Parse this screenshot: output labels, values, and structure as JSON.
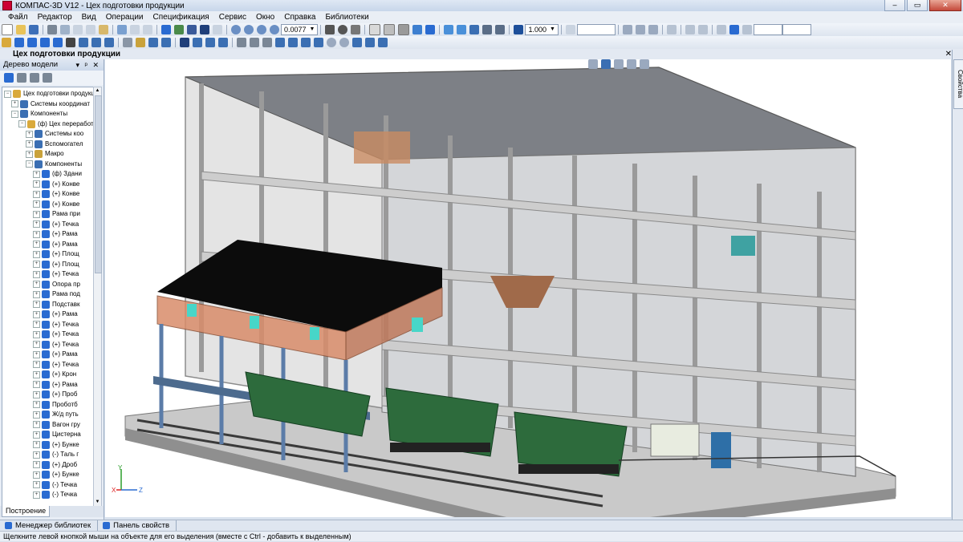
{
  "window": {
    "title": "КОМПАС-3D V12 - Цех подготовки продукции"
  },
  "menu": [
    "Файл",
    "Редактор",
    "Вид",
    "Операции",
    "Спецификация",
    "Сервис",
    "Окно",
    "Справка",
    "Библиотеки"
  ],
  "toolbar": {
    "scale_value": "0.0077",
    "step_value": "1.000"
  },
  "document_tab": {
    "title": "Цех подготовки продукции"
  },
  "model_tree": {
    "header": "Дерево модели",
    "items": [
      {
        "label": "Цех подготовки продукции",
        "level": 0,
        "icon": "assembly-icon"
      },
      {
        "label": "Системы координат",
        "level": 1,
        "icon": "coordinate-system-icon"
      },
      {
        "label": "Компоненты",
        "level": 1,
        "icon": "components-icon"
      },
      {
        "label": "(ф) Цех переработки",
        "level": 2,
        "icon": "assembly-icon"
      },
      {
        "label": "Системы коо",
        "level": 3,
        "icon": "coordinate-system-icon"
      },
      {
        "label": "Вспомогател",
        "level": 3,
        "icon": "auxiliary-geometry-icon"
      },
      {
        "label": "Макро",
        "level": 3,
        "icon": "macro-icon"
      },
      {
        "label": "Компоненты",
        "level": 3,
        "icon": "components-icon"
      },
      {
        "label": "(ф) Здани",
        "level": 4,
        "icon": "part-icon"
      },
      {
        "label": "(+) Конве",
        "level": 4,
        "icon": "part-icon"
      },
      {
        "label": "(+) Конве",
        "level": 4,
        "icon": "part-icon"
      },
      {
        "label": "(+) Конве",
        "level": 4,
        "icon": "part-icon"
      },
      {
        "label": "Рама при",
        "level": 4,
        "icon": "part-icon"
      },
      {
        "label": "(+) Течка",
        "level": 4,
        "icon": "part-icon"
      },
      {
        "label": "(+) Рама",
        "level": 4,
        "icon": "part-icon"
      },
      {
        "label": "(+) Рама",
        "level": 4,
        "icon": "part-icon"
      },
      {
        "label": "(+) Площ",
        "level": 4,
        "icon": "part-icon"
      },
      {
        "label": "(+) Площ",
        "level": 4,
        "icon": "part-icon"
      },
      {
        "label": "(+) Течка",
        "level": 4,
        "icon": "part-icon"
      },
      {
        "label": "Опора пр",
        "level": 4,
        "icon": "part-icon"
      },
      {
        "label": "Рама под",
        "level": 4,
        "icon": "part-icon"
      },
      {
        "label": "Подставк",
        "level": 4,
        "icon": "part-icon"
      },
      {
        "label": "(+) Рама",
        "level": 4,
        "icon": "part-icon"
      },
      {
        "label": "(+) Течка",
        "level": 4,
        "icon": "part-icon"
      },
      {
        "label": "(+) Течка",
        "level": 4,
        "icon": "part-icon"
      },
      {
        "label": "(+) Течка",
        "level": 4,
        "icon": "part-icon"
      },
      {
        "label": "(+) Рама",
        "level": 4,
        "icon": "part-icon"
      },
      {
        "label": "(+) Течка",
        "level": 4,
        "icon": "part-icon"
      },
      {
        "label": "(+) Крон",
        "level": 4,
        "icon": "part-icon"
      },
      {
        "label": "(+) Рама",
        "level": 4,
        "icon": "part-icon"
      },
      {
        "label": "(+) Проб",
        "level": 4,
        "icon": "part-icon"
      },
      {
        "label": "Проботб",
        "level": 4,
        "icon": "part-icon"
      },
      {
        "label": "Ж/д путь",
        "level": 4,
        "icon": "part-icon"
      },
      {
        "label": "Вагон гру",
        "level": 4,
        "icon": "part-icon"
      },
      {
        "label": "Цистерна",
        "level": 4,
        "icon": "part-icon"
      },
      {
        "label": "(+) Бунке",
        "level": 4,
        "icon": "part-icon"
      },
      {
        "label": "(-) Таль г",
        "level": 4,
        "icon": "part-icon"
      },
      {
        "label": "(+) Дроб",
        "level": 4,
        "icon": "part-icon"
      },
      {
        "label": "(+) Бунке",
        "level": 4,
        "icon": "part-icon"
      },
      {
        "label": "(-) Течка",
        "level": 4,
        "icon": "part-icon"
      },
      {
        "label": "(-) Течка",
        "level": 4,
        "icon": "part-icon"
      }
    ],
    "bottom_tab": "Построение"
  },
  "right_panel": {
    "tab": "Свойства"
  },
  "bottom_tabs": [
    "Менеджер библиотек",
    "Панель свойств"
  ],
  "status_bar": {
    "text": "Щелкните левой кнопкой мыши на объекте для его выделения (вместе с Ctrl - добавить к выделенным)"
  },
  "colors": {
    "accent": "#2a6bd1",
    "roof": "#0d0d0d",
    "wall": "#d98c6a",
    "wagon": "#2d6b3c",
    "floor": "#c8c8c8"
  },
  "axes": {
    "x": "X",
    "y": "Y",
    "z": "Z"
  }
}
